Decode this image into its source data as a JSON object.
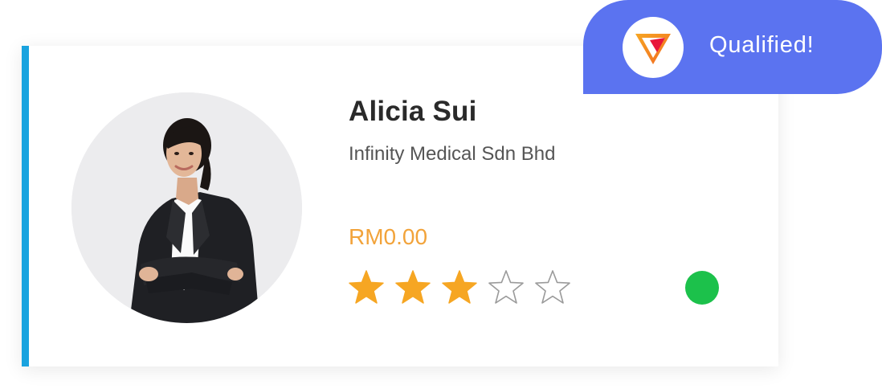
{
  "card": {
    "name": "Alicia Sui",
    "company": "Infinity Medical Sdn Bhd",
    "price": "RM0.00",
    "rating": {
      "value": 3,
      "max": 5
    },
    "status": {
      "color": "#1cc14b"
    },
    "accent_color": "#1aa3df"
  },
  "badge": {
    "label": "Qualified!",
    "background": "#5b73f0",
    "logo_icon": "v-triangle-logo-icon"
  },
  "colors": {
    "star_filled": "#f6a623",
    "star_empty_stroke": "#9a9a9a",
    "price": "#f2a33a"
  }
}
